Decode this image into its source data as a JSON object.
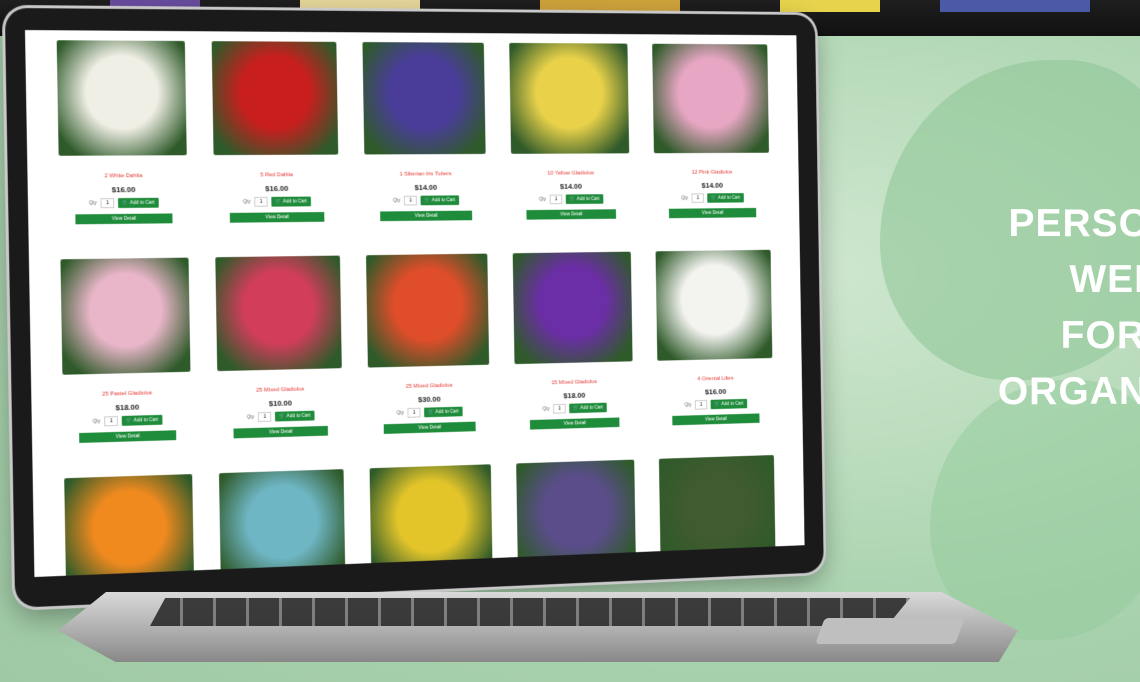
{
  "headline": {
    "line1": "PERSO",
    "line2": "WEI",
    "line3": "FOR",
    "line4": "ORGAN"
  },
  "products": [
    {
      "name": "2 White Dahlia",
      "price": "$16.00",
      "qty_label": "Qty",
      "qty": "1",
      "cart": "Add to Cart",
      "detail": "View Detail",
      "color": "#f0efe6"
    },
    {
      "name": "5 Red Dahlia",
      "price": "$16.00",
      "qty_label": "Qty",
      "qty": "1",
      "cart": "Add to Cart",
      "detail": "View Detail",
      "color": "#c81e1e"
    },
    {
      "name": "1 Siberian Iris Tubers",
      "price": "$14.00",
      "qty_label": "Qty",
      "qty": "1",
      "cart": "Add to Cart",
      "detail": "View Detail",
      "color": "#4a3d9a"
    },
    {
      "name": "10 Yellow Gladiolus",
      "price": "$14.00",
      "qty_label": "Qty",
      "qty": "1",
      "cart": "Add to Cart",
      "detail": "View Detail",
      "color": "#e9d24a"
    },
    {
      "name": "12 Pink Gladiolus",
      "price": "$14.00",
      "qty_label": "Qty",
      "qty": "1",
      "cart": "Add to Cart",
      "detail": "View Detail",
      "color": "#e7a6c3"
    },
    {
      "name": "25 Pastel Gladiolus",
      "price": "$18.00",
      "qty_label": "Qty",
      "qty": "1",
      "cart": "Add to Cart",
      "detail": "View Detail",
      "color": "#e9b6c9"
    },
    {
      "name": "25 Mixed Gladiolus",
      "price": "$10.00",
      "qty_label": "Qty",
      "qty": "1",
      "cart": "Add to Cart",
      "detail": "View Detail",
      "color": "#d23d5a"
    },
    {
      "name": "25 Mixed Gladiolus",
      "price": "$30.00",
      "qty_label": "Qty",
      "qty": "1",
      "cart": "Add to Cart",
      "detail": "View Detail",
      "color": "#e04d2a"
    },
    {
      "name": "15 Mixed Gladiolus",
      "price": "$18.00",
      "qty_label": "Qty",
      "qty": "1",
      "cart": "Add to Cart",
      "detail": "View Detail",
      "color": "#6b2ea6"
    },
    {
      "name": "4 Oriental Lilies",
      "price": "$16.00",
      "qty_label": "Qty",
      "qty": "1",
      "cart": "Add to Cart",
      "detail": "View Detail",
      "color": "#f3f3f0"
    },
    {
      "name": "",
      "price": "",
      "qty_label": "",
      "qty": "",
      "cart": "",
      "detail": "",
      "color": "#f08a1f"
    },
    {
      "name": "",
      "price": "",
      "qty_label": "",
      "qty": "",
      "cart": "",
      "detail": "",
      "color": "#6fb6c4"
    },
    {
      "name": "",
      "price": "",
      "qty_label": "",
      "qty": "",
      "cart": "",
      "detail": "",
      "color": "#e3c52a"
    },
    {
      "name": "",
      "price": "",
      "qty_label": "",
      "qty": "",
      "cart": "",
      "detail": "",
      "color": "#5a4d8a"
    },
    {
      "name": "",
      "price": "",
      "qty_label": "",
      "qty": "",
      "cart": "",
      "detail": "",
      "color": "#3f5b2f"
    }
  ],
  "colors": {
    "accent_green": "#1f8c3b",
    "name_red": "#e53935",
    "background_green": "#a9d2ae"
  }
}
